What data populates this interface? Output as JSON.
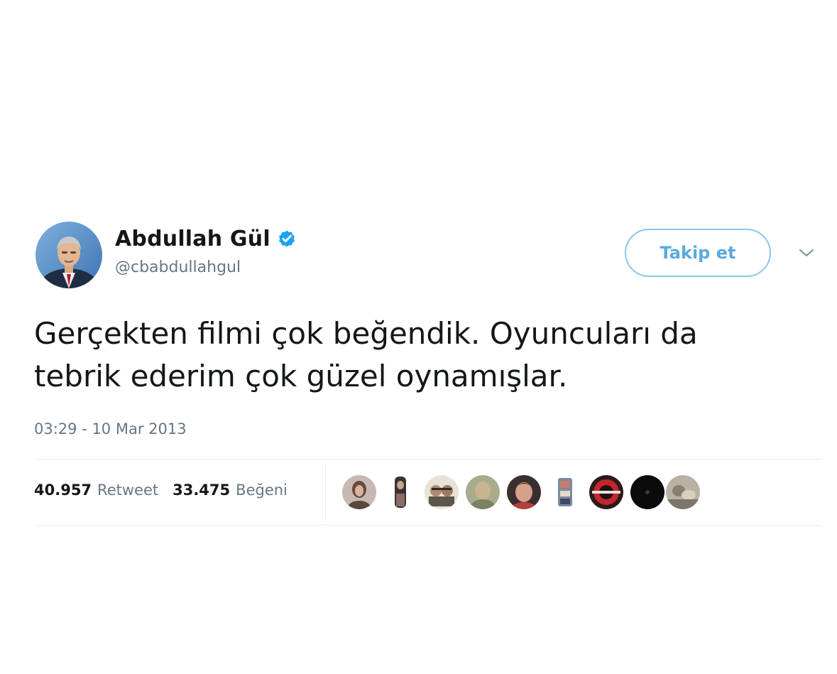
{
  "tweet": {
    "author": {
      "name": "Abdullah Gül",
      "handle": "@cbabdullahgul",
      "verified": true,
      "verified_color": "#1da1f2"
    },
    "follow_button": {
      "label": "Takip et",
      "color": "#5aa9dd"
    },
    "menu_icon": "chevron-down-icon",
    "text_lines": [
      "Gerçekten filmi çok beğendik. Oyuncuları da",
      "tebrik ederim çok güzel oynamışlar."
    ],
    "timestamp": "03:29 - 10 Mar 2013",
    "stats": {
      "retweets": {
        "count": "40.957",
        "label": "Retweet"
      },
      "likes": {
        "count": "33.475",
        "label": "Beğeni"
      }
    },
    "likers_count_shown": 9
  }
}
